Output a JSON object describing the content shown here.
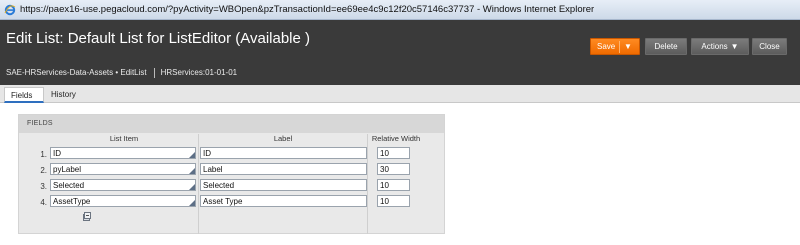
{
  "window": {
    "title": "https://paex16-use.pegacloud.com/?pyActivity=WBOpen&pzTransactionId=ee69ee4c9c12f20c57146c37737 - Windows Internet Explorer"
  },
  "header": {
    "title": "Edit List: Default List for ListEditor  (Available )",
    "breadcrumb": "SAE-HRServices-Data-Assets • EditList",
    "ruleset": "HRServices:01-01-01",
    "buttons": {
      "save": "Save",
      "delete": "Delete",
      "actions": "Actions",
      "close": "Close"
    },
    "accent_color": "#f57600"
  },
  "tabs": [
    {
      "label": "Fields",
      "active": true
    },
    {
      "label": "History",
      "active": false
    }
  ],
  "fields_panel": {
    "title": "FIELDS",
    "columns": {
      "list_item": "List Item",
      "label": "Label",
      "relative_width": "Relative Width"
    },
    "rows": [
      {
        "num": "1.",
        "list_item": "ID",
        "label": "ID",
        "width": "10"
      },
      {
        "num": "2.",
        "list_item": "pyLabel",
        "label": "Label",
        "width": "30"
      },
      {
        "num": "3.",
        "list_item": "Selected",
        "label": "Selected",
        "width": "10"
      },
      {
        "num": "4.",
        "list_item": "AssetType",
        "label": "Asset Type",
        "width": "10"
      }
    ]
  },
  "icons": {
    "browser": "ie-icon",
    "add_row": "add-row-icon",
    "picker": "smart-prompt-icon"
  }
}
